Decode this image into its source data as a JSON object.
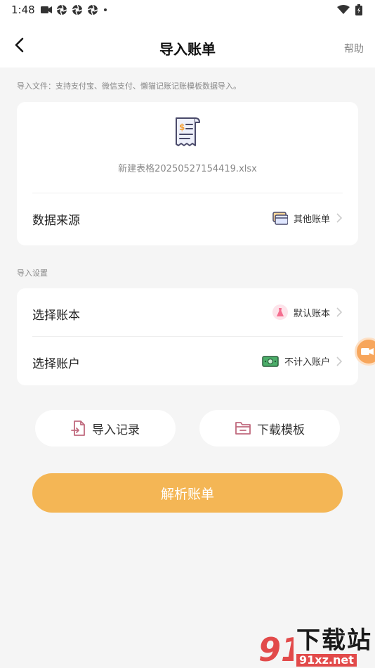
{
  "status_bar": {
    "time": "1:48"
  },
  "nav": {
    "title": "导入账单",
    "help": "帮助"
  },
  "import_file": {
    "hint": "导入文件：支持支付宝、微信支付、懒猫记账记账模板数据导入。",
    "file_name": "新建表格20250527154419.xlsx",
    "data_source_label": "数据来源",
    "data_source_value": "其他账单"
  },
  "import_settings": {
    "hint": "导入设置",
    "book_label": "选择账本",
    "book_value": "默认账本",
    "account_label": "选择账户",
    "account_value": "不计入账户"
  },
  "actions": {
    "import_records": "导入记录",
    "download_template": "下载模板",
    "parse": "解析账单"
  },
  "watermark": {
    "text_top": "下载站",
    "text_bottom": "91xz.net"
  },
  "colors": {
    "accent": "#f4b655",
    "background": "#f5f5f5"
  }
}
